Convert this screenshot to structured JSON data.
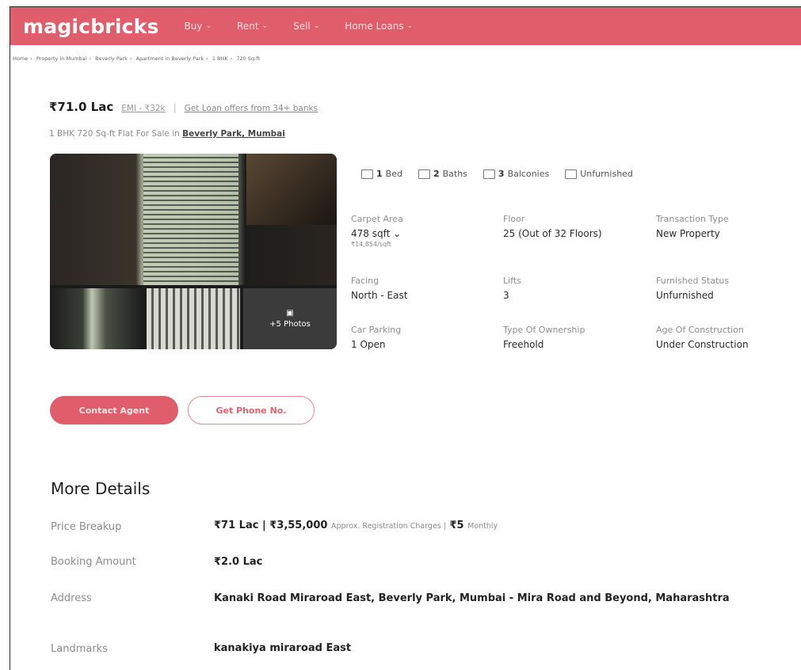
{
  "nav": {
    "logo": "magicbricks",
    "items": [
      {
        "label": "Buy"
      },
      {
        "label": "Rent"
      },
      {
        "label": "Sell"
      },
      {
        "label": "Home Loans"
      }
    ]
  },
  "breadcrumb": [
    "Home",
    "Property in Mumbai",
    "Beverly Park",
    "Apartment in Beverly Park",
    "1 BHK",
    "720 Sq-ft"
  ],
  "listing": {
    "price": "₹71.0 Lac",
    "emi": "EMI - ₹32k",
    "loan_offer": "Get Loan offers from 34+ banks",
    "subtitle": "1 BHK 720 Sq-ft Flat For Sale in",
    "location_link": "Beverly Park, Mumbai"
  },
  "gallery": {
    "more_photos": "+5 Photos"
  },
  "features": [
    {
      "icon": "bed-icon",
      "count": "1",
      "label": "Bed"
    },
    {
      "icon": "bath-icon",
      "count": "2",
      "label": "Baths"
    },
    {
      "icon": "balcony-icon",
      "count": "3",
      "label": "Balconies"
    },
    {
      "icon": "furnishing-icon",
      "count": "",
      "label": "Unfurnished"
    }
  ],
  "details": {
    "carpet_area": {
      "label": "Carpet Area",
      "value": "478 sqft",
      "sub": "₹14,854/sqft"
    },
    "floor": {
      "label": "Floor",
      "value": "25 (Out of 32 Floors)"
    },
    "transaction": {
      "label": "Transaction Type",
      "value": "New Property"
    },
    "facing": {
      "label": "Facing",
      "value": "North - East"
    },
    "lifts": {
      "label": "Lifts",
      "value": "3"
    },
    "furnished": {
      "label": "Furnished Status",
      "value": "Unfurnished"
    },
    "parking": {
      "label": "Car Parking",
      "value": "1 Open"
    },
    "ownership": {
      "label": "Type Of Ownership",
      "value": "Freehold"
    },
    "age": {
      "label": "Age Of Construction",
      "value": "Under Construction"
    }
  },
  "buttons": {
    "contact_agent": "Contact Agent",
    "get_phone": "Get Phone No."
  },
  "more_details": {
    "title": "More Details",
    "price_breakup": {
      "label": "Price Breakup",
      "price": "₹71 Lac | ₹3,55,000",
      "reg_note": "Approx. Registration Charges |",
      "maintenance": "₹5",
      "maint_note": "Monthly"
    },
    "booking": {
      "label": "Booking Amount",
      "value": "₹2.0 Lac"
    },
    "address": {
      "label": "Address",
      "value": "Kanaki Road Miraroad East, Beverly Park, Mumbai - Mira Road and Beyond, Maharashtra"
    },
    "landmarks": {
      "label": "Landmarks",
      "value": "kanakiya miraroad East"
    }
  },
  "colors": {
    "brand": "#e05e6b"
  }
}
